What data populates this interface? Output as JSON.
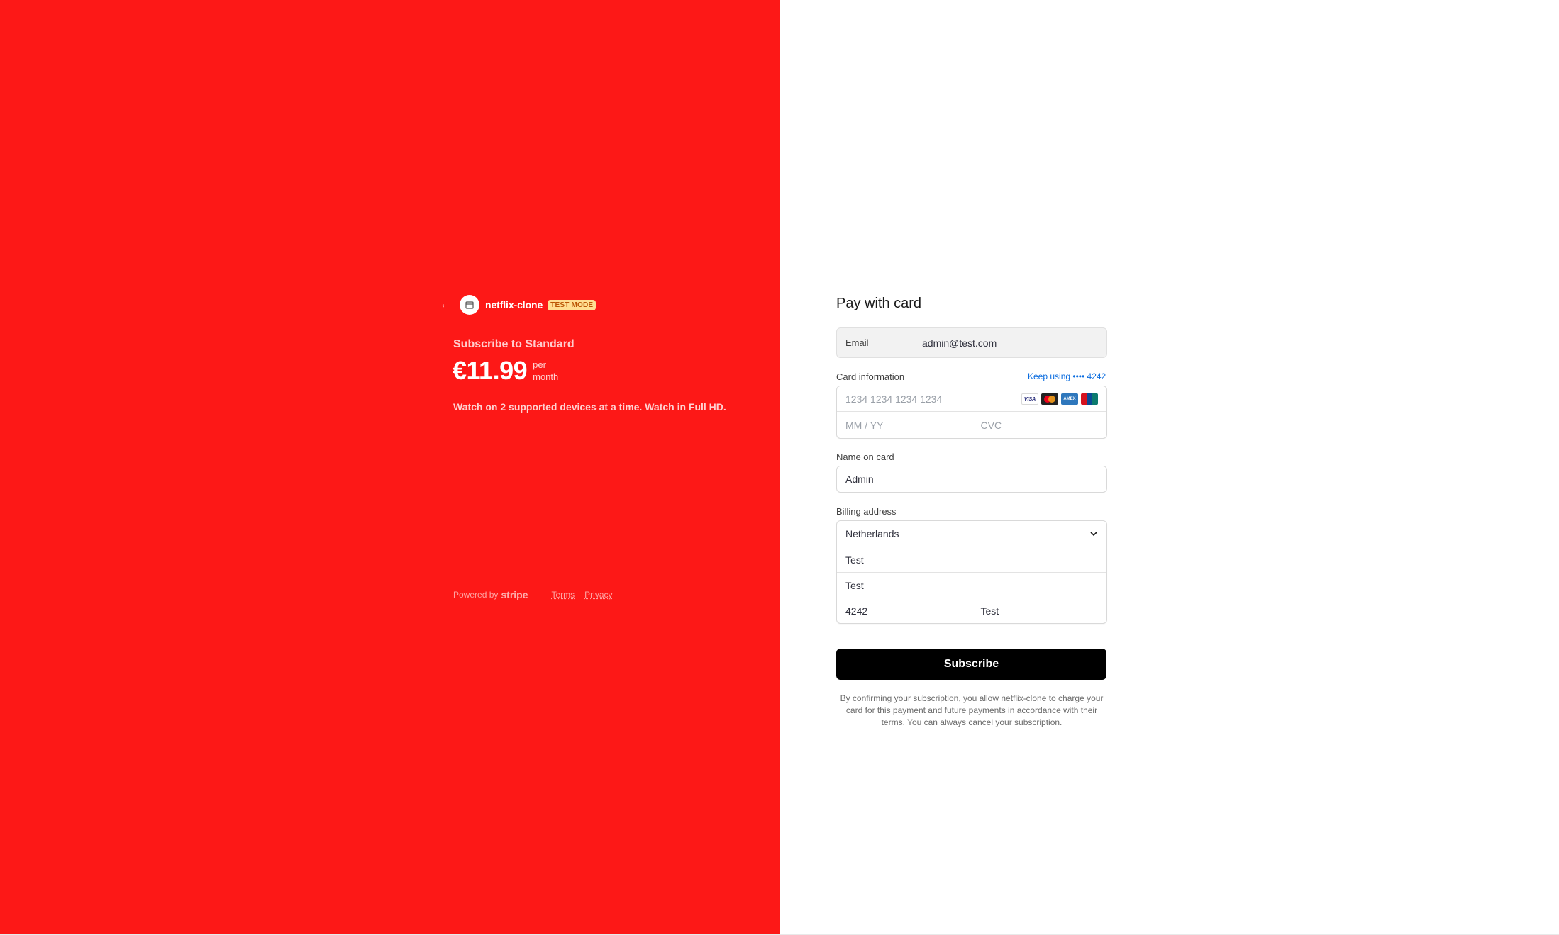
{
  "summary": {
    "back_icon": "arrow-left-icon",
    "merchant_name": "netflix-clone",
    "test_badge": "TEST MODE",
    "product_title": "Subscribe to Standard",
    "price": "€11.99",
    "interval_line1": "per",
    "interval_line2": "month",
    "description": "Watch on 2 supported devices at a time. Watch in Full HD.",
    "powered_by": "Powered by",
    "stripe_word": "stripe",
    "terms_link": "Terms",
    "privacy_link": "Privacy"
  },
  "form": {
    "title": "Pay with card",
    "email_label": "Email",
    "email_value": "admin@test.com",
    "card_label": "Card information",
    "keep_using": "Keep using •••• 4242",
    "card_number_placeholder": "1234 1234 1234 1234",
    "expiry_placeholder": "MM / YY",
    "cvc_placeholder": "CVC",
    "card_brands": [
      "VISA",
      "mastercard",
      "AMEX",
      "UnionPay"
    ],
    "name_label": "Name on card",
    "name_value": "Admin",
    "billing_label": "Billing address",
    "country": "Netherlands",
    "address_line1": "Test",
    "address_line2": "Test",
    "postal_code": "4242",
    "city": "Test",
    "subscribe_label": "Subscribe",
    "terms_text": "By confirming your subscription, you allow netflix-clone to charge your card for this payment and future payments in accordance with their terms. You can always cancel your subscription."
  },
  "colors": {
    "brand_panel": "#fd1817",
    "button": "#000000",
    "link": "#0a6cdf",
    "badge_bg": "#ffde92"
  }
}
